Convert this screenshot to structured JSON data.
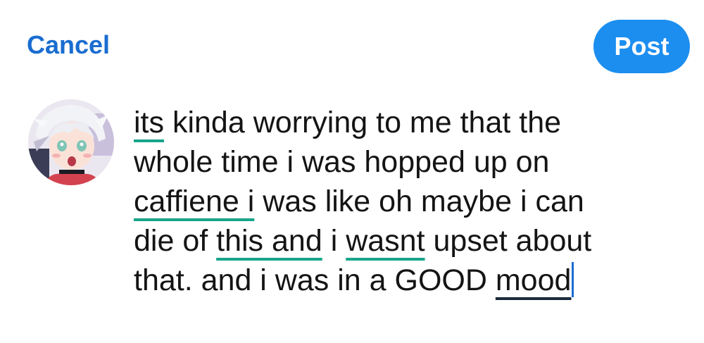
{
  "header": {
    "cancel_label": "Cancel",
    "post_label": "Post"
  },
  "composer": {
    "lines": [
      [
        {
          "t": "its",
          "u": "teal"
        },
        {
          "t": " kinda worrying to me that the"
        }
      ],
      [
        {
          "t": "whole time i was hopped up on"
        }
      ],
      [
        {
          "t": "caffiene i",
          "u": "teal"
        },
        {
          "t": " was like oh maybe i can"
        }
      ],
      [
        {
          "t": "die of "
        },
        {
          "t": "this and",
          "u": "teal"
        },
        {
          "t": " i "
        },
        {
          "t": "wasnt",
          "u": "teal"
        },
        {
          "t": " upset about"
        }
      ],
      [
        {
          "t": "that. and i was in a GOOD "
        },
        {
          "t": "mood",
          "u": "dark"
        }
      ]
    ]
  },
  "colors": {
    "accent": "#1c8ef0",
    "cancel": "#1a6dd0",
    "spellcheck_underline": "#18a58a",
    "autocorrect_underline": "#1a2a3a"
  }
}
